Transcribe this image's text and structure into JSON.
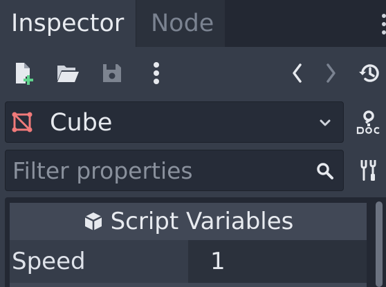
{
  "tabs": [
    {
      "label": "Inspector",
      "active": true
    },
    {
      "label": "Node",
      "active": false
    }
  ],
  "toolbar": {
    "icons": [
      "new-resource-icon",
      "open-folder-icon",
      "save-icon",
      "more-options-icon",
      "history-back-icon",
      "history-forward-icon",
      "object-history-icon"
    ]
  },
  "node_select": {
    "name": "Cube",
    "icon": "mesh-instance-icon",
    "accent": "#f07a7a"
  },
  "filter": {
    "placeholder": "Filter properties",
    "value": ""
  },
  "section": {
    "title": "Script Variables"
  },
  "properties": [
    {
      "label": "Speed",
      "value": "1"
    }
  ]
}
